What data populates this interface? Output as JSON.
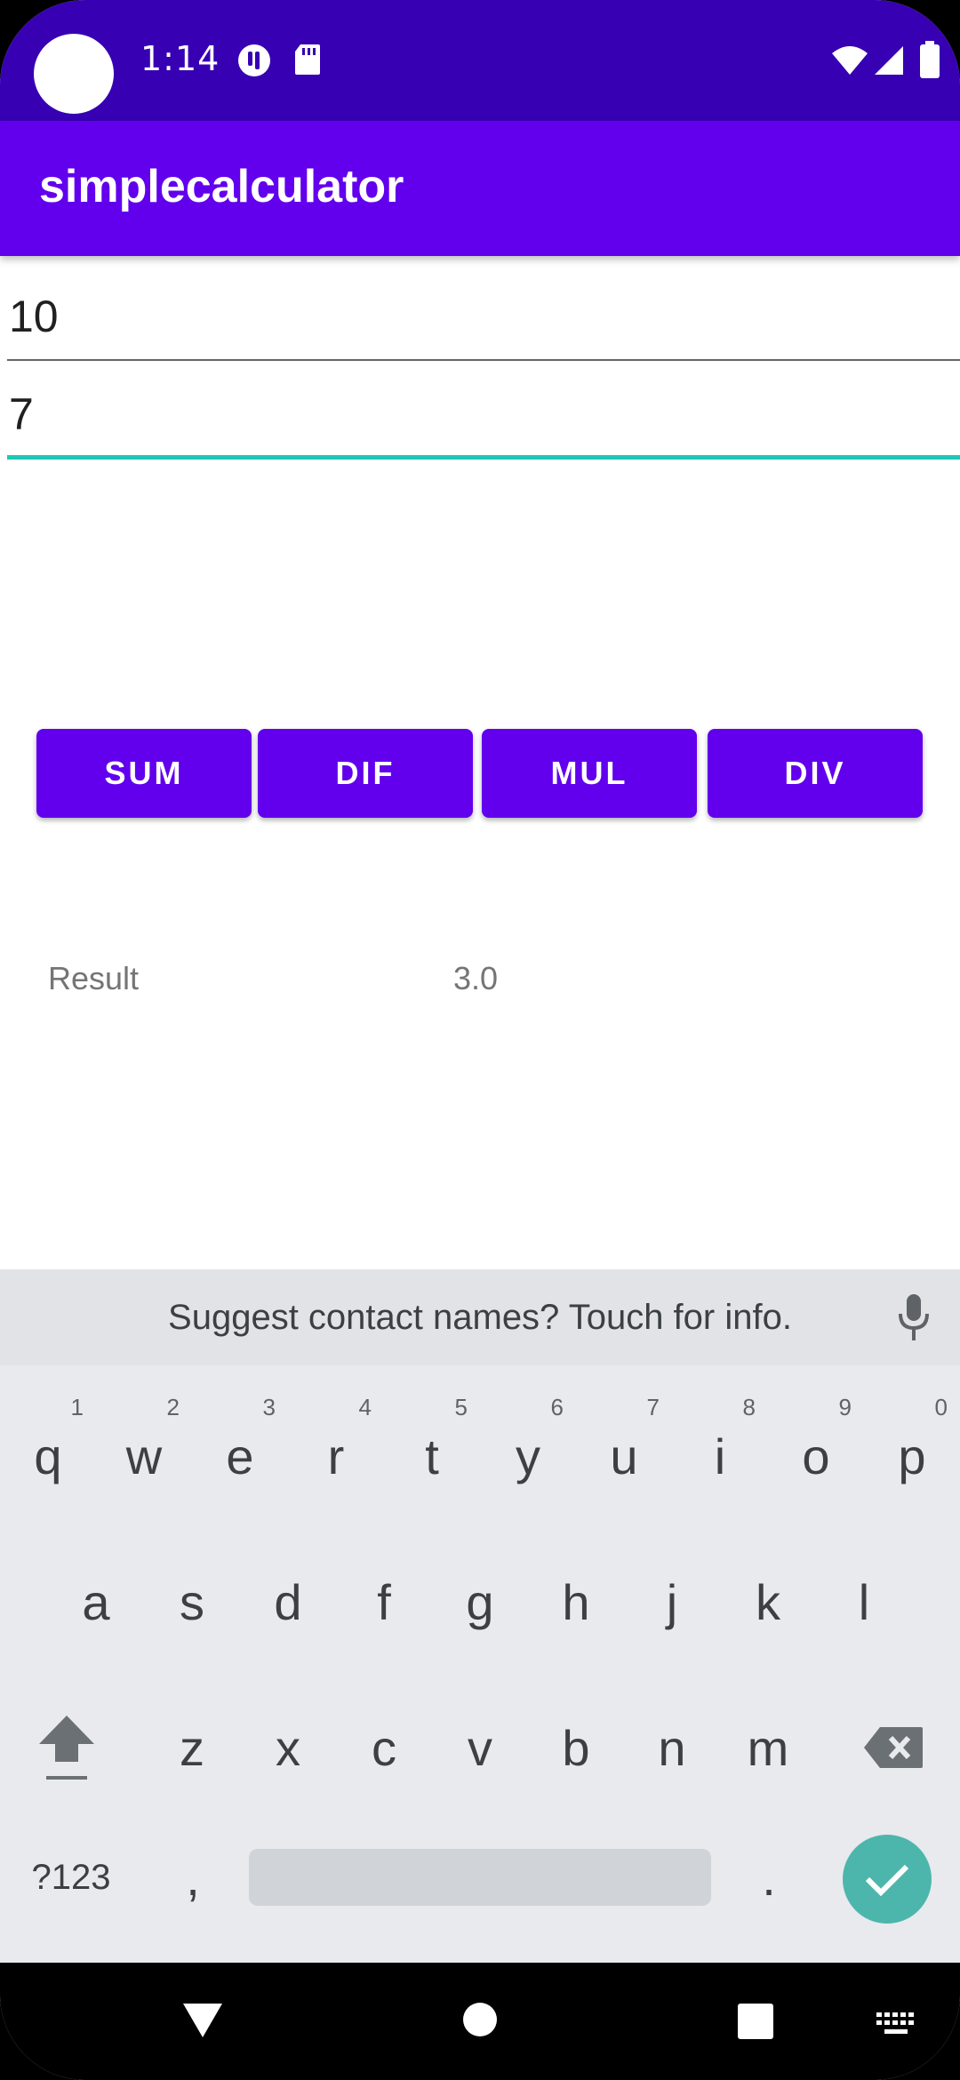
{
  "status_bar": {
    "time": "1:14",
    "icons": [
      "camera-cutout",
      "notification-app-icon",
      "sd-card-icon",
      "wifi-icon",
      "signal-icon",
      "battery-icon"
    ]
  },
  "app_bar": {
    "title": "simplecalculator",
    "color": "#6200ee"
  },
  "inputs": {
    "first_value": "10",
    "second_value": "7",
    "focus_color": "#1ec8b4"
  },
  "buttons": {
    "sum": "SUM",
    "dif": "DIF",
    "mul": "MUL",
    "div": "DIV"
  },
  "result": {
    "label": "Result",
    "value": "3.0"
  },
  "keyboard": {
    "suggestion": "Suggest contact names? Touch for info.",
    "row1": [
      {
        "key": "q",
        "hint": "1"
      },
      {
        "key": "w",
        "hint": "2"
      },
      {
        "key": "e",
        "hint": "3"
      },
      {
        "key": "r",
        "hint": "4"
      },
      {
        "key": "t",
        "hint": "5"
      },
      {
        "key": "y",
        "hint": "6"
      },
      {
        "key": "u",
        "hint": "7"
      },
      {
        "key": "i",
        "hint": "8"
      },
      {
        "key": "o",
        "hint": "9"
      },
      {
        "key": "p",
        "hint": "0"
      }
    ],
    "row2": [
      "a",
      "s",
      "d",
      "f",
      "g",
      "h",
      "j",
      "k",
      "l"
    ],
    "row3": [
      "z",
      "x",
      "c",
      "v",
      "b",
      "n",
      "m"
    ],
    "symbols_label": "?123",
    "comma": ",",
    "period": ".",
    "accent_color": "#4db6ac"
  }
}
